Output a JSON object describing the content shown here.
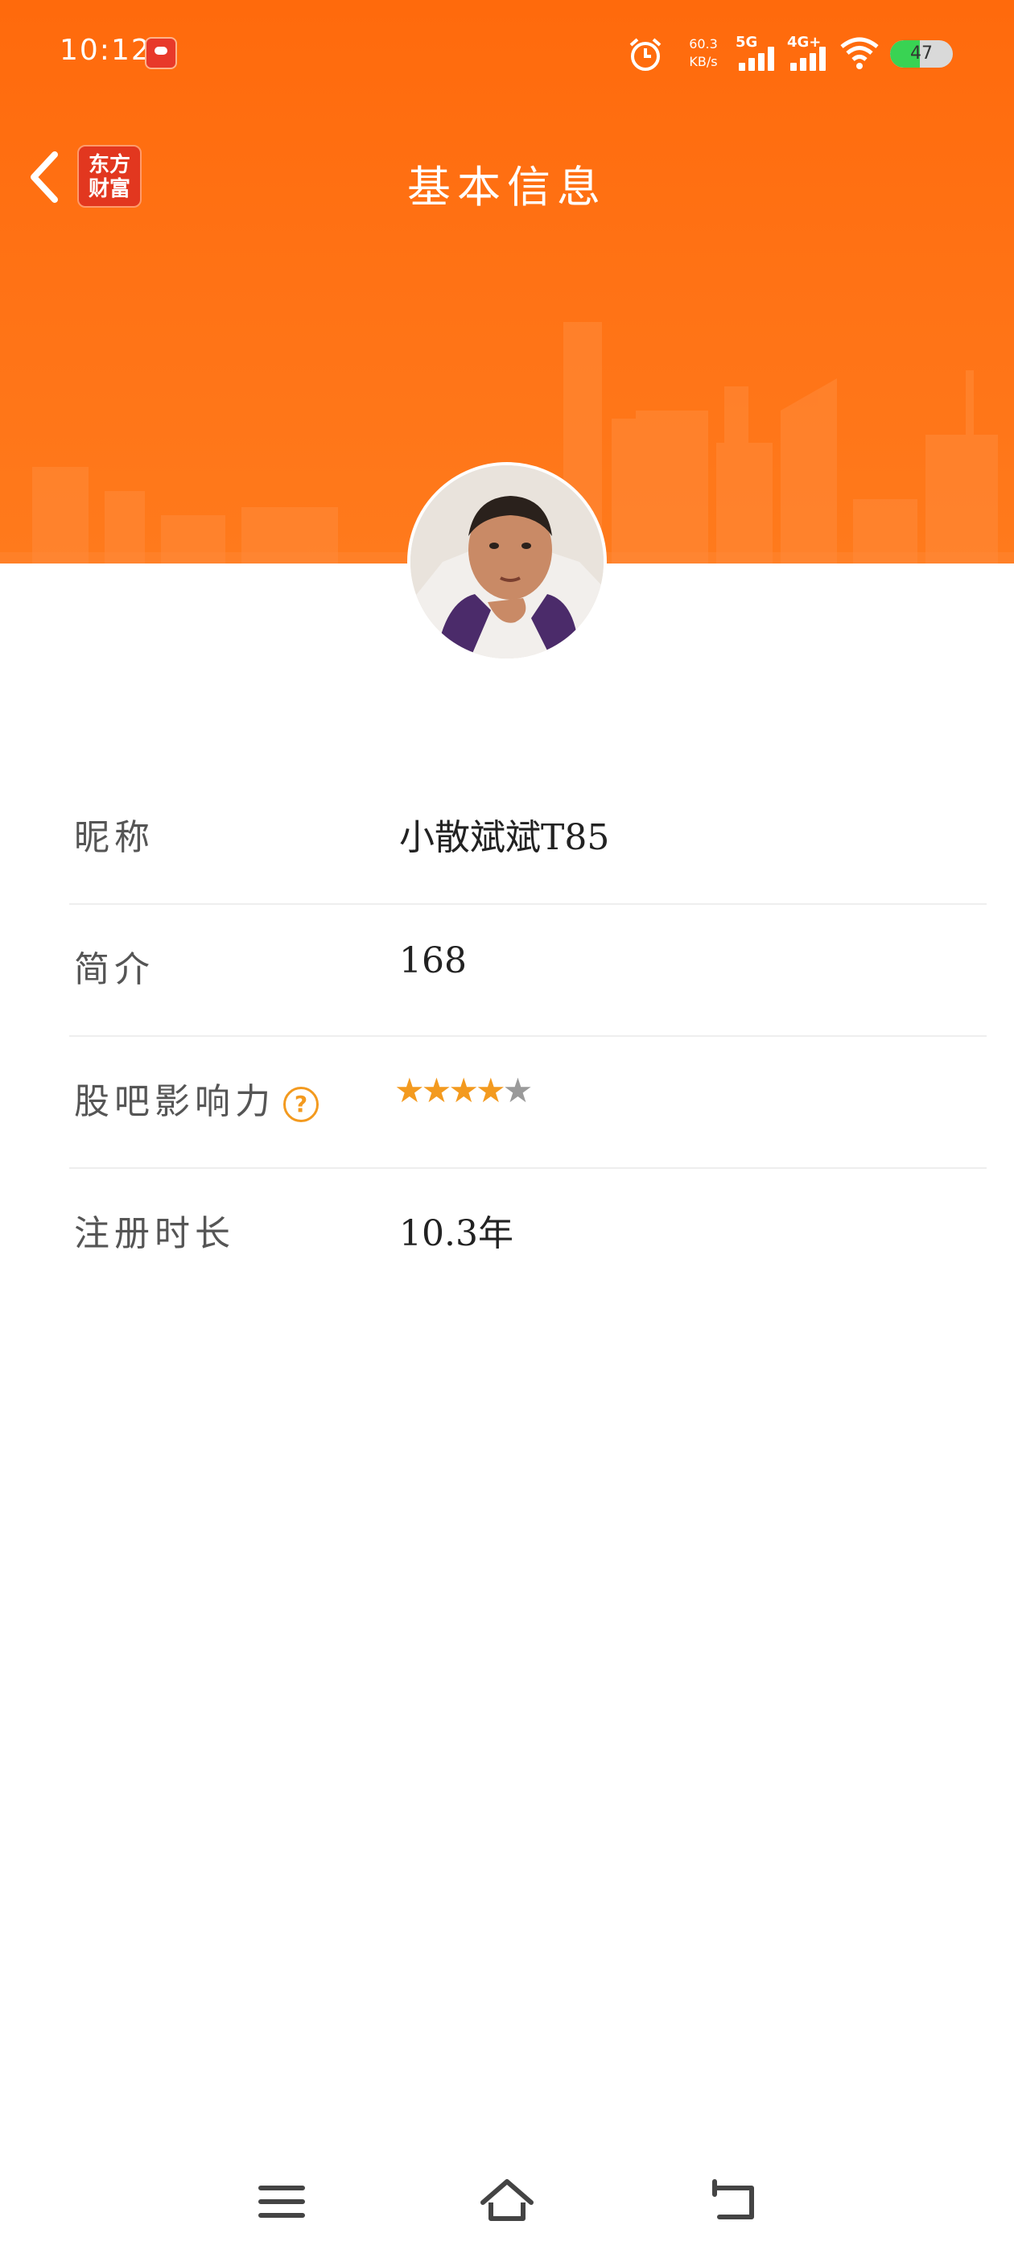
{
  "status_bar": {
    "time": "10:12",
    "net_speed_value": "60.3",
    "net_speed_unit": "KB/s",
    "signal1_label": "5G",
    "signal2_label": "4G+",
    "battery": "47"
  },
  "header": {
    "app_logo_line1": "东方",
    "app_logo_line2": "财富",
    "title": "基本信息"
  },
  "profile": {
    "rows": [
      {
        "label": "昵称",
        "value": "小散斌斌T85"
      },
      {
        "label": "简介",
        "value": "168"
      },
      {
        "label": "股吧影响力",
        "help_icon": "?",
        "stars_filled": 4,
        "stars_total": 5
      },
      {
        "label": "注册时长",
        "value": "10.3年"
      }
    ]
  },
  "colors": {
    "header_orange": "#ff7316",
    "star_active": "#f39a1f",
    "star_inactive": "#9a9a9a"
  }
}
